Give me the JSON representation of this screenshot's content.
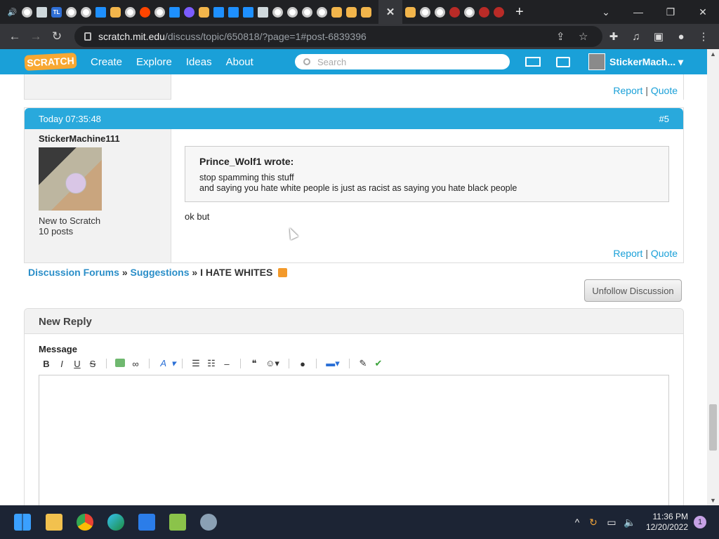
{
  "browser": {
    "url_host": "scratch.mit.edu",
    "url_path": "/discuss/topic/650818/?page=1#post-6839396",
    "active_tab_close": "✕",
    "new_tab": "+"
  },
  "site_nav": {
    "logo": "SCRATCH",
    "create": "Create",
    "explore": "Explore",
    "ideas": "Ideas",
    "about": "About",
    "search_placeholder": "Search",
    "username": "StickerMach..."
  },
  "previous_post": {
    "report": "Report",
    "sep": "|",
    "quote": "Quote"
  },
  "post": {
    "time": "Today 07:35:48",
    "number": "#5",
    "author": "StickerMachine111",
    "rank": "New to Scratch",
    "post_count": "10 posts",
    "quote_author": "Prince_Wolf1 wrote:",
    "quote_line1": "stop spamming this stuff",
    "quote_line2": "and saying you hate white people is just as racist as saying you hate black people",
    "body": "ok but",
    "report": "Report",
    "sep": "|",
    "quote": "Quote"
  },
  "breadcrumb": {
    "forums": "Discussion Forums",
    "sep1": "»",
    "category": "Suggestions",
    "sep2": "»",
    "topic": "I HATE WHITES"
  },
  "unfollow_label": "Unfollow Discussion",
  "new_reply": {
    "heading": "New Reply",
    "message_label": "Message",
    "toolbar": {
      "bold": "B",
      "italic": "I",
      "underline": "U",
      "strike": "S",
      "font": "A"
    }
  },
  "taskbar": {
    "time": "11:36 PM",
    "date": "12/20/2022",
    "notifications": "1"
  },
  "colors": {
    "scratch_blue": "#1aa0d8",
    "post_header": "#29a9dc",
    "link": "#2a8ec8"
  }
}
